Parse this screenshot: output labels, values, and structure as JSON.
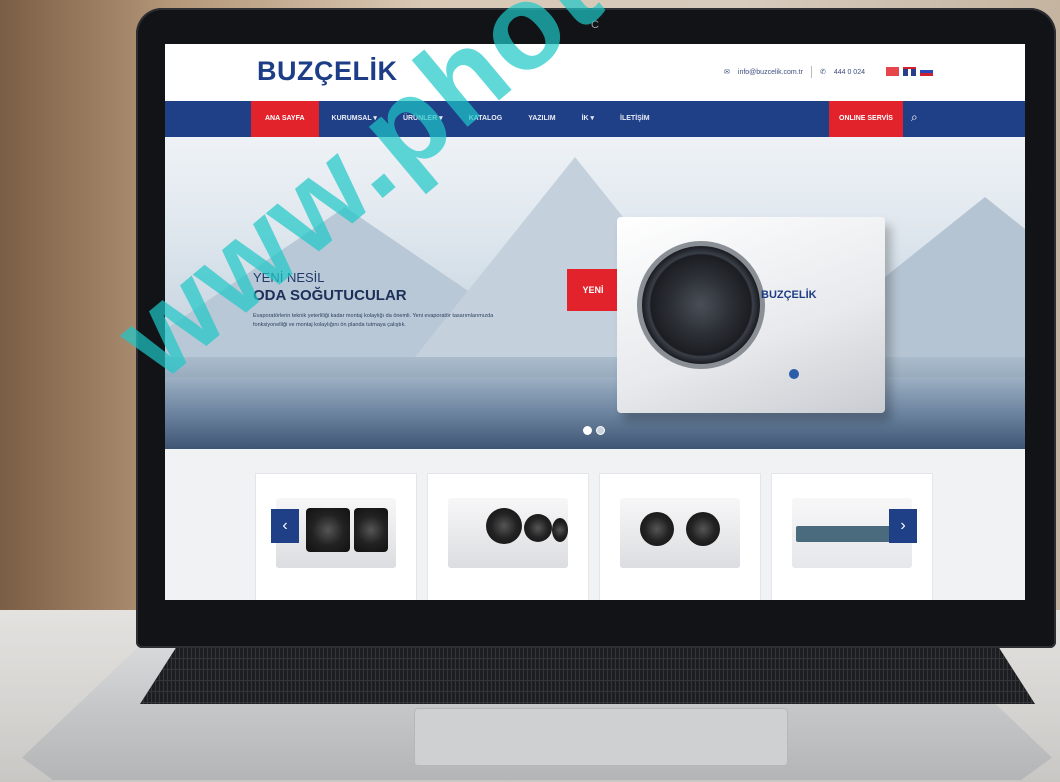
{
  "site": {
    "logo": "BUZÇELİK",
    "email": "info@buzcelik.com.tr",
    "phone": "444 0 024"
  },
  "nav": {
    "items": [
      "ANA SAYFA",
      "KURUMSAL ▾",
      "ÜRÜNLER ▾",
      "KATALOG",
      "YAZILIM",
      "İK ▾",
      "İLETİŞİM"
    ],
    "online_service": "ONLINE SERVİS",
    "search_icon": "search-icon"
  },
  "hero": {
    "subtitle": "YENİ NESİL",
    "title": "ODA SOĞUTUCULAR",
    "description": "Evaporatörlerin teknik yeterliliği kadar montaj kolaylığı da önemli. Yeni evaporatör tasarımlarımızda fonksiyonelliği ve montaj kolaylığını ön planda tutmaya çalıştık.",
    "badge": "YENİ",
    "product_brand": "BUZÇELİK",
    "slide_count": 2,
    "active_slide": 1
  },
  "products": {
    "prev_icon": "chevron-left-icon",
    "next_icon": "chevron-right-icon",
    "prev_label": "‹",
    "next_label": "›"
  },
  "device": {
    "camera_label": "C"
  },
  "watermark": "www.photobd.co",
  "colors": {
    "brand_blue": "#1f3f86",
    "accent_red": "#e2232b",
    "watermark": "#1ec8c8"
  }
}
